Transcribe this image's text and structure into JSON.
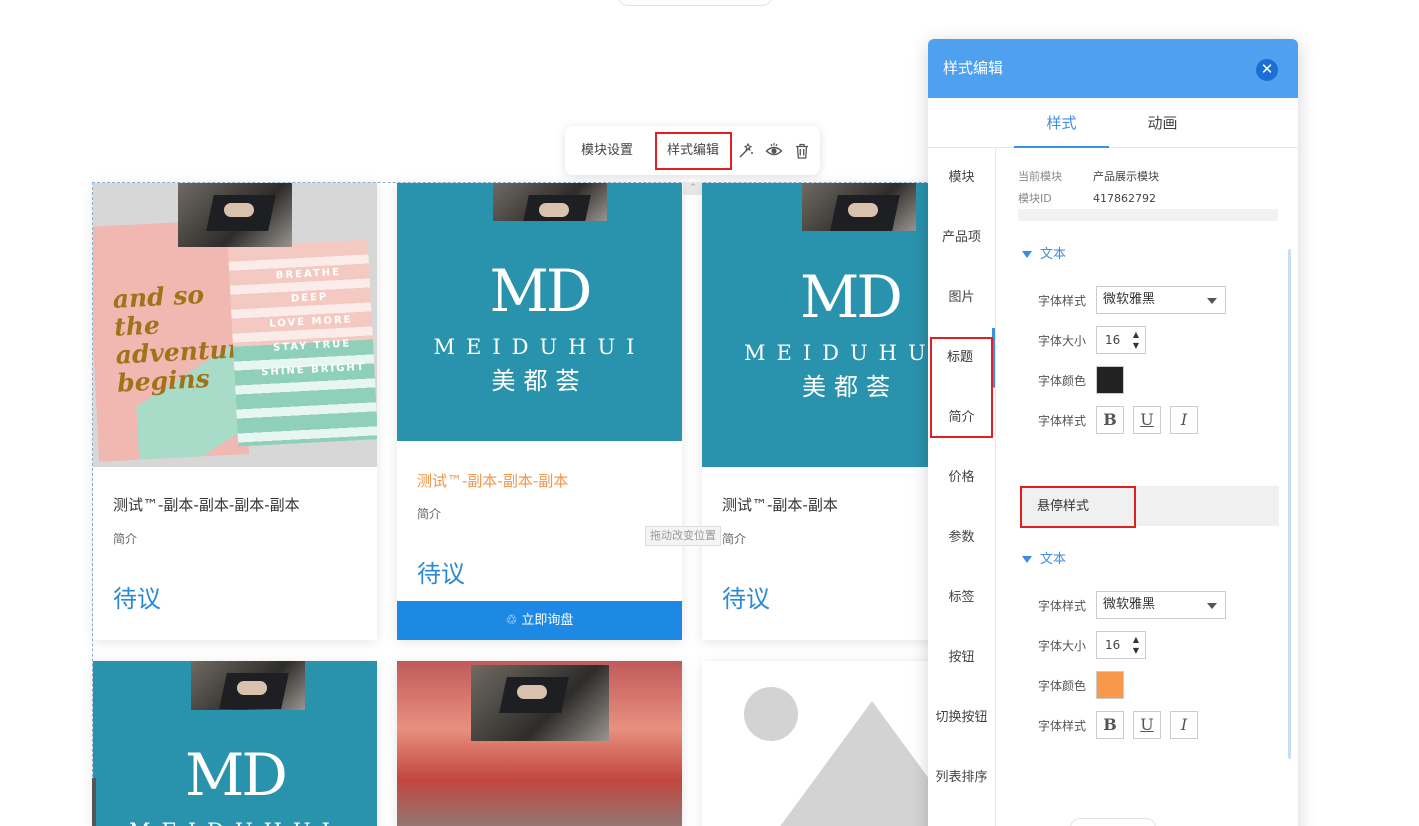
{
  "toolbar": {
    "settings_label": "模块设置",
    "style_label": "样式编辑",
    "icons": [
      "magic-wand-icon",
      "eye-icon",
      "trash-icon"
    ]
  },
  "drag_tip": "拖动改变位置",
  "cards": [
    {
      "title": "测试™-副本-副本-副本-副本",
      "desc": "简介",
      "price": "待议",
      "image": "book-photo"
    },
    {
      "title": "测试™-副本-副本-副本",
      "desc": "简介",
      "price": "待议",
      "image": "meiduhui-logo",
      "inquiry": "立即询盘"
    },
    {
      "title": "测试™-副本-副本",
      "desc": "简介",
      "price": "待议",
      "image": "meiduhui-logo"
    },
    {
      "image": "meiduhui-logo"
    },
    {
      "image": "tree-photo"
    },
    {
      "image": "placeholder"
    }
  ],
  "logo": {
    "md": "MD",
    "en": "MEIDUHUI",
    "cn": "美都荟"
  },
  "book_text": {
    "script": "and so the adventure begins",
    "stripes": [
      "BREATHE",
      "DEEP",
      "LOVE MORE",
      "STAY TRUE",
      "SHINE BRIGHT"
    ]
  },
  "panel": {
    "title": "样式编辑",
    "tabs": [
      "样式",
      "动画"
    ],
    "active_tab": "样式",
    "side_items": [
      "模块",
      "产品项",
      "图片",
      "标题",
      "简介",
      "价格",
      "参数",
      "标签",
      "按钮",
      "切换按钮",
      "列表排序"
    ],
    "meta": {
      "current_module_key": "当前模块",
      "current_module_value": "产品展示模块",
      "module_id_key": "模块ID",
      "module_id_value": "417862792"
    },
    "section_label": "文本",
    "hover_label": "悬停样式",
    "labels": {
      "font_style": "字体样式",
      "font_size": "字体大小",
      "font_color": "字体颜色",
      "font_format": "字体样式"
    },
    "normal": {
      "font": "微软雅黑",
      "size": "16",
      "color": "#222222"
    },
    "hover": {
      "font": "微软雅黑",
      "size": "16",
      "color": "#f7984a"
    },
    "format_buttons": [
      "B",
      "U",
      "I"
    ]
  },
  "colors": {
    "accent": "#3a8ee6",
    "header": "#4fa1f0",
    "highlight": "#e02020",
    "teal": "#2992ac",
    "inquiry": "#1e88e5"
  }
}
